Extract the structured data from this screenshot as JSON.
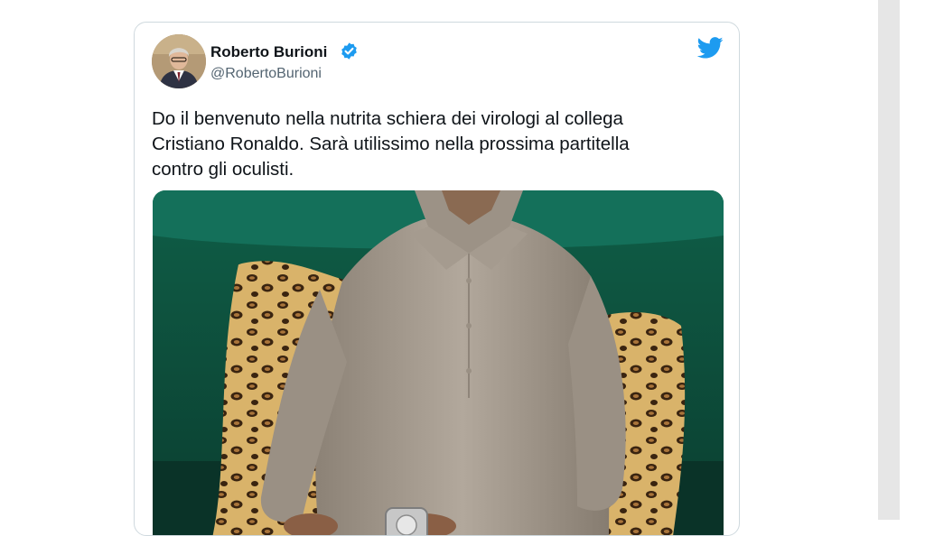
{
  "tweet": {
    "author_name": "Roberto Burioni",
    "handle": "@RobertoBurioni",
    "text_lines": [
      "Do il benvenuto nella nutrita schiera dei virologi al collega",
      "Cristiano Ronaldo. Sarà utilissimo nella prossima partitella",
      "contro gli oculisti."
    ],
    "verified": true
  },
  "icons": {
    "verified": "verified-badge-icon",
    "brand": "twitter-bird-icon"
  },
  "colors": {
    "brand_blue": "#1d9bf0",
    "text": "#0f1419",
    "muted": "#536471",
    "border": "#cfd9de"
  }
}
